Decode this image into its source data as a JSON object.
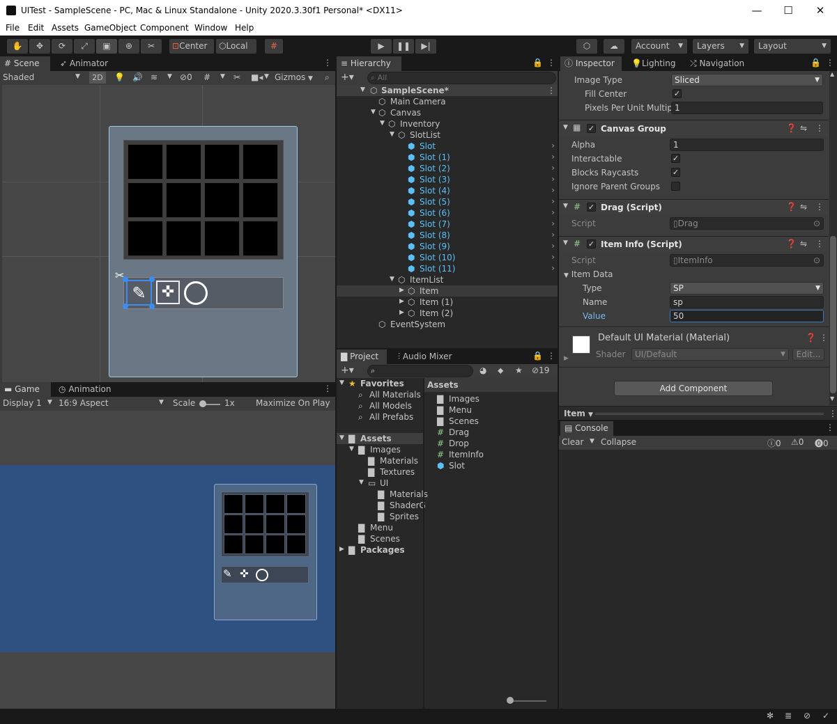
{
  "window": {
    "title": "UITest - SampleScene - PC, Mac & Linux Standalone - Unity 2020.3.30f1 Personal* <DX11>",
    "minimize": "—",
    "maximize": "☐",
    "close": "✕"
  },
  "menu": [
    "File",
    "Edit",
    "Assets",
    "GameObject",
    "Component",
    "Window",
    "Help"
  ],
  "toolbar": {
    "pivot_label": "Center",
    "space_label": "Local",
    "account_label": "Account",
    "layers_label": "Layers",
    "layout_label": "Layout"
  },
  "scene_panel": {
    "tabs": [
      "Scene",
      "Animator"
    ],
    "shading": "Shaded",
    "mode_2d": "2D",
    "hidden_count": "0",
    "gizmos_label": "Gizmos"
  },
  "game_panel": {
    "tabs": [
      "Game",
      "Animation"
    ],
    "display": "Display 1",
    "aspect": "16:9 Aspect",
    "scale_label": "Scale",
    "scale_value": "1x",
    "maximize_label": "Maximize On Play"
  },
  "hierarchy": {
    "tab": "Hierarchy",
    "search_placeholder": "All",
    "scene": "SampleScene*",
    "items": [
      {
        "label": "Main Camera"
      },
      {
        "label": "Canvas"
      },
      {
        "label": "Inventory"
      },
      {
        "label": "SlotList"
      },
      {
        "label": "Slot"
      },
      {
        "label": "Slot (1)"
      },
      {
        "label": "Slot (2)"
      },
      {
        "label": "Slot (3)"
      },
      {
        "label": "Slot (4)"
      },
      {
        "label": "Slot (5)"
      },
      {
        "label": "Slot (6)"
      },
      {
        "label": "Slot (7)"
      },
      {
        "label": "Slot (8)"
      },
      {
        "label": "Slot (9)"
      },
      {
        "label": "Slot (10)"
      },
      {
        "label": "Slot (11)"
      },
      {
        "label": "ItemList"
      },
      {
        "label": "Item"
      },
      {
        "label": "Item (1)"
      },
      {
        "label": "Item (2)"
      },
      {
        "label": "EventSystem"
      }
    ]
  },
  "project": {
    "tabs": [
      "Project",
      "Audio Mixer"
    ],
    "hidden_count": "19",
    "favorites_label": "Favorites",
    "favorites": [
      "All Materials",
      "All Models",
      "All Prefabs"
    ],
    "assets_label": "Assets",
    "tree": [
      "Images",
      "Materials",
      "Textures",
      "UI",
      "Materials",
      "ShaderG",
      "Sprites",
      "Menu",
      "Scenes"
    ],
    "packages_label": "Packages",
    "breadcrumb": "Assets",
    "files": [
      "Images",
      "Menu",
      "Scenes",
      "Drag",
      "Drop",
      "ItemInfo",
      "Slot"
    ]
  },
  "inspector": {
    "tabs": [
      "Inspector",
      "Lighting",
      "Navigation"
    ],
    "image_type_label": "Image Type",
    "image_type_value": "Sliced",
    "fill_center_label": "Fill Center",
    "ppu_label": "Pixels Per Unit Multipli",
    "ppu_value": "1",
    "canvas_group": {
      "title": "Canvas Group",
      "alpha_label": "Alpha",
      "alpha_value": "1",
      "interactable_label": "Interactable",
      "blocks_label": "Blocks Raycasts",
      "ignore_label": "Ignore Parent Groups"
    },
    "drag_script": {
      "title": "Drag (Script)",
      "script_label": "Script",
      "script_value": "Drag"
    },
    "item_info": {
      "title": "Item Info (Script)",
      "script_label": "Script",
      "script_value": "ItemInfo",
      "item_data_label": "Item Data",
      "type_label": "Type",
      "type_value": "SP",
      "name_label": "Name",
      "name_value": "sp",
      "value_label": "Value",
      "value_value": "50"
    },
    "material": {
      "title": "Default UI Material (Material)",
      "shader_label": "Shader",
      "shader_value": "UI/Default",
      "edit_label": "Edit..."
    },
    "add_component": "Add Component",
    "preview_label": "Item"
  },
  "console": {
    "tab": "Console",
    "clear": "Clear",
    "collapse": "Collapse",
    "info_count": "0",
    "warn_count": "0",
    "error_count": "0"
  },
  "colors": {
    "accent_blue": "#5bc0f5",
    "game_bg": "#2f5181",
    "selection": "#3a3a3a"
  }
}
